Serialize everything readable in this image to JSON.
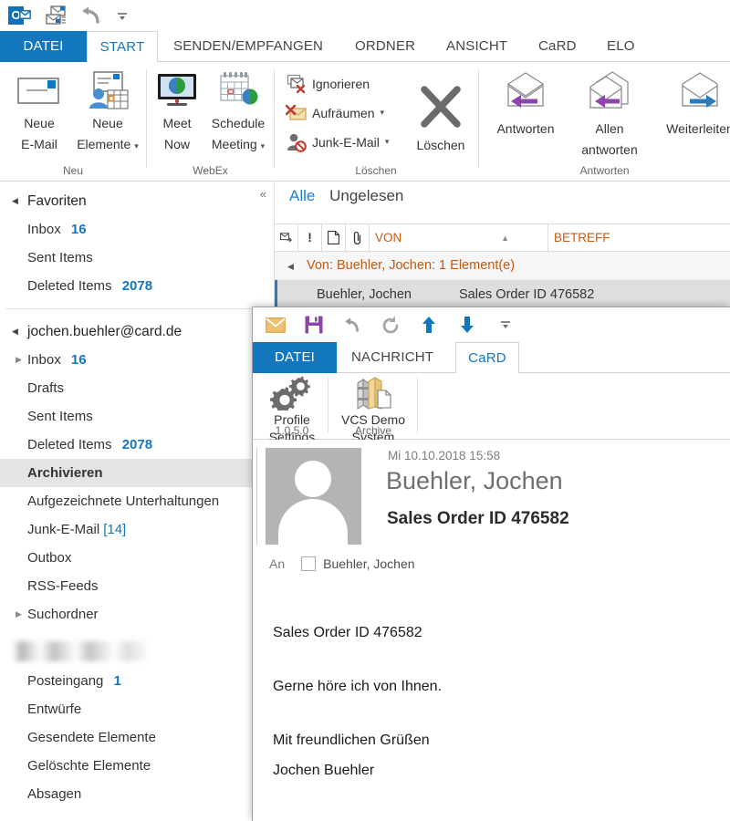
{
  "quick_access": {
    "logo_text": "O",
    "items": [
      {
        "name": "outlook-logo",
        "label": "Outlook"
      },
      {
        "name": "send-receive-all-icon",
        "label": "Alle Ordner senden/empfangen"
      },
      {
        "name": "undo-icon",
        "label": "Rückgängig"
      },
      {
        "name": "customize-qat-icon",
        "label": "Symbolleiste für den Schnellzugriff anpassen"
      }
    ]
  },
  "ribbon": {
    "tabs": [
      {
        "label": "DATEI",
        "state": "file"
      },
      {
        "label": "START",
        "state": "active"
      },
      {
        "label": "SENDEN/EMPFANGEN",
        "state": "normal"
      },
      {
        "label": "ORDNER",
        "state": "normal"
      },
      {
        "label": "ANSICHT",
        "state": "normal"
      },
      {
        "label": "CaRD",
        "state": "normal"
      },
      {
        "label": "ELO",
        "state": "normal"
      }
    ],
    "groups": [
      {
        "label": "Neu",
        "buttons": [
          {
            "label_line1": "Neue",
            "label_line2": "E-Mail",
            "icon": "new-email-icon",
            "has_caret": false
          },
          {
            "label_line1": "Neue",
            "label_line2": "Elemente",
            "icon": "new-items-icon",
            "has_caret": true
          }
        ]
      },
      {
        "label": "WebEx",
        "buttons": [
          {
            "label_line1": "Meet",
            "label_line2": "Now",
            "icon": "meet-now-icon",
            "has_caret": false
          },
          {
            "label_line1": "Schedule",
            "label_line2": "Meeting",
            "icon": "schedule-meeting-icon",
            "has_caret": true
          }
        ]
      },
      {
        "label": "Löschen",
        "small_buttons": [
          {
            "label": "Ignorieren",
            "icon": "ignore-icon",
            "has_caret": false
          },
          {
            "label": "Aufräumen",
            "icon": "cleanup-icon",
            "has_caret": true
          },
          {
            "label": "Junk-E-Mail",
            "icon": "junk-email-icon",
            "has_caret": true
          }
        ],
        "buttons": [
          {
            "label_line1": "Löschen",
            "label_line2": "",
            "icon": "delete-x-icon",
            "has_caret": false
          }
        ]
      },
      {
        "label": "Antworten",
        "buttons": [
          {
            "label_line1": "Antworten",
            "label_line2": "",
            "icon": "reply-icon",
            "has_caret": false
          },
          {
            "label_line1": "Allen",
            "label_line2": "antworten",
            "icon": "reply-all-icon",
            "has_caret": false
          },
          {
            "label_line1": "Weiterleiten",
            "label_line2": "",
            "icon": "forward-icon",
            "has_caret": false
          }
        ]
      }
    ]
  },
  "nav_pane": {
    "collapse_icon": "«",
    "sections": [
      {
        "header": {
          "label": "Favoriten",
          "expanded": true
        },
        "items": [
          {
            "label": "Inbox",
            "count": "16",
            "twisty": "none"
          },
          {
            "label": "Sent Items",
            "count": "",
            "twisty": "none"
          },
          {
            "label": "Deleted Items",
            "count": "2078",
            "twisty": "none"
          }
        ]
      },
      {
        "header": {
          "label": "jochen.buehler@card.de",
          "expanded": true
        },
        "items": [
          {
            "label": "Inbox",
            "count": "16",
            "twisty": "collapsed"
          },
          {
            "label": "Drafts",
            "count": "",
            "twisty": "none"
          },
          {
            "label": "Sent Items",
            "count": "",
            "twisty": "none"
          },
          {
            "label": "Deleted Items",
            "count": "2078",
            "twisty": "none"
          },
          {
            "label": "Archivieren",
            "count": "",
            "twisty": "none",
            "selected": true
          },
          {
            "label": "Aufgezeichnete Unterhaltungen",
            "count": "",
            "twisty": "none"
          },
          {
            "label": "Junk-E-Mail",
            "count_bracket": "[14]",
            "count": "",
            "twisty": "none"
          },
          {
            "label": "Outbox",
            "count": "",
            "twisty": "none"
          },
          {
            "label": "RSS-Feeds",
            "count": "",
            "twisty": "none"
          },
          {
            "label": "Suchordner",
            "count": "",
            "twisty": "collapsed"
          }
        ]
      },
      {
        "header": {
          "label": "",
          "redacted": true
        },
        "items": [
          {
            "label": "Posteingang",
            "count": "1",
            "twisty": "none"
          },
          {
            "label": "Entwürfe",
            "count": "",
            "twisty": "none"
          },
          {
            "label": "Gesendete Elemente",
            "count": "",
            "twisty": "none"
          },
          {
            "label": "Gelöschte Elemente",
            "count": "",
            "twisty": "none"
          },
          {
            "label": "Absagen",
            "count": "",
            "twisty": "none"
          }
        ]
      }
    ]
  },
  "message_list": {
    "filters": {
      "all": "Alle",
      "unread": "Ungelesen"
    },
    "columns": [
      {
        "name": "message-icon-column",
        "label": ""
      },
      {
        "name": "importance-column",
        "label": "!"
      },
      {
        "name": "reminder-column",
        "label": ""
      },
      {
        "name": "attachment-column",
        "label": ""
      },
      {
        "name": "from-column",
        "label": "VON",
        "sorted": "asc"
      },
      {
        "name": "subject-column",
        "label": "BETREFF"
      }
    ],
    "group_row": "Von: Buehler, Jochen: 1 Element(e)",
    "rows": [
      {
        "from": "Buehler, Jochen",
        "subject": "Sales Order ID 476582",
        "selected": true
      }
    ]
  },
  "inspector": {
    "quick_access": [
      {
        "name": "send-envelope-icon",
        "label": "Senden"
      },
      {
        "name": "save-icon",
        "label": "Speichern"
      },
      {
        "name": "undo-icon",
        "label": "Rückgängig"
      },
      {
        "name": "redo-icon",
        "label": "Wiederholen"
      },
      {
        "name": "previous-item-icon",
        "label": "Vorheriges Element"
      },
      {
        "name": "next-item-icon",
        "label": "Nächstes Element"
      },
      {
        "name": "customize-qat-icon",
        "label": "Anpassen"
      }
    ],
    "tabs": [
      {
        "label": "DATEI",
        "state": "file"
      },
      {
        "label": "NACHRICHT",
        "state": "normal"
      },
      {
        "label": "CaRD",
        "state": "active"
      }
    ],
    "ribbon_groups": [
      {
        "label": "1.0.5.0",
        "buttons": [
          {
            "label_line1": "Profile",
            "label_line2": "Settings",
            "icon": "gears-icon"
          }
        ]
      },
      {
        "label": "Archive",
        "buttons": [
          {
            "label_line1": "VCS Demo",
            "label_line2": "System",
            "icon": "archive-books-icon"
          }
        ]
      }
    ],
    "header": {
      "date": "Mi 10.10.2018 15:58",
      "from": "Buehler, Jochen",
      "subject": "Sales Order ID 476582",
      "to_label": "An",
      "to_recipient": "Buehler, Jochen"
    },
    "body": {
      "paragraphs": [
        "Sales Order ID 476582",
        "Gerne höre ich von Ihnen.",
        "Mit freundlichen Grüßen"
      ],
      "signature": "Jochen Buehler"
    }
  },
  "colors": {
    "accent_blue": "#1277bc",
    "link_blue": "#1c7fd6",
    "header_orange": "#c55a11",
    "selected_row": "#dedede",
    "selection_bar": "#2a7ab9"
  }
}
